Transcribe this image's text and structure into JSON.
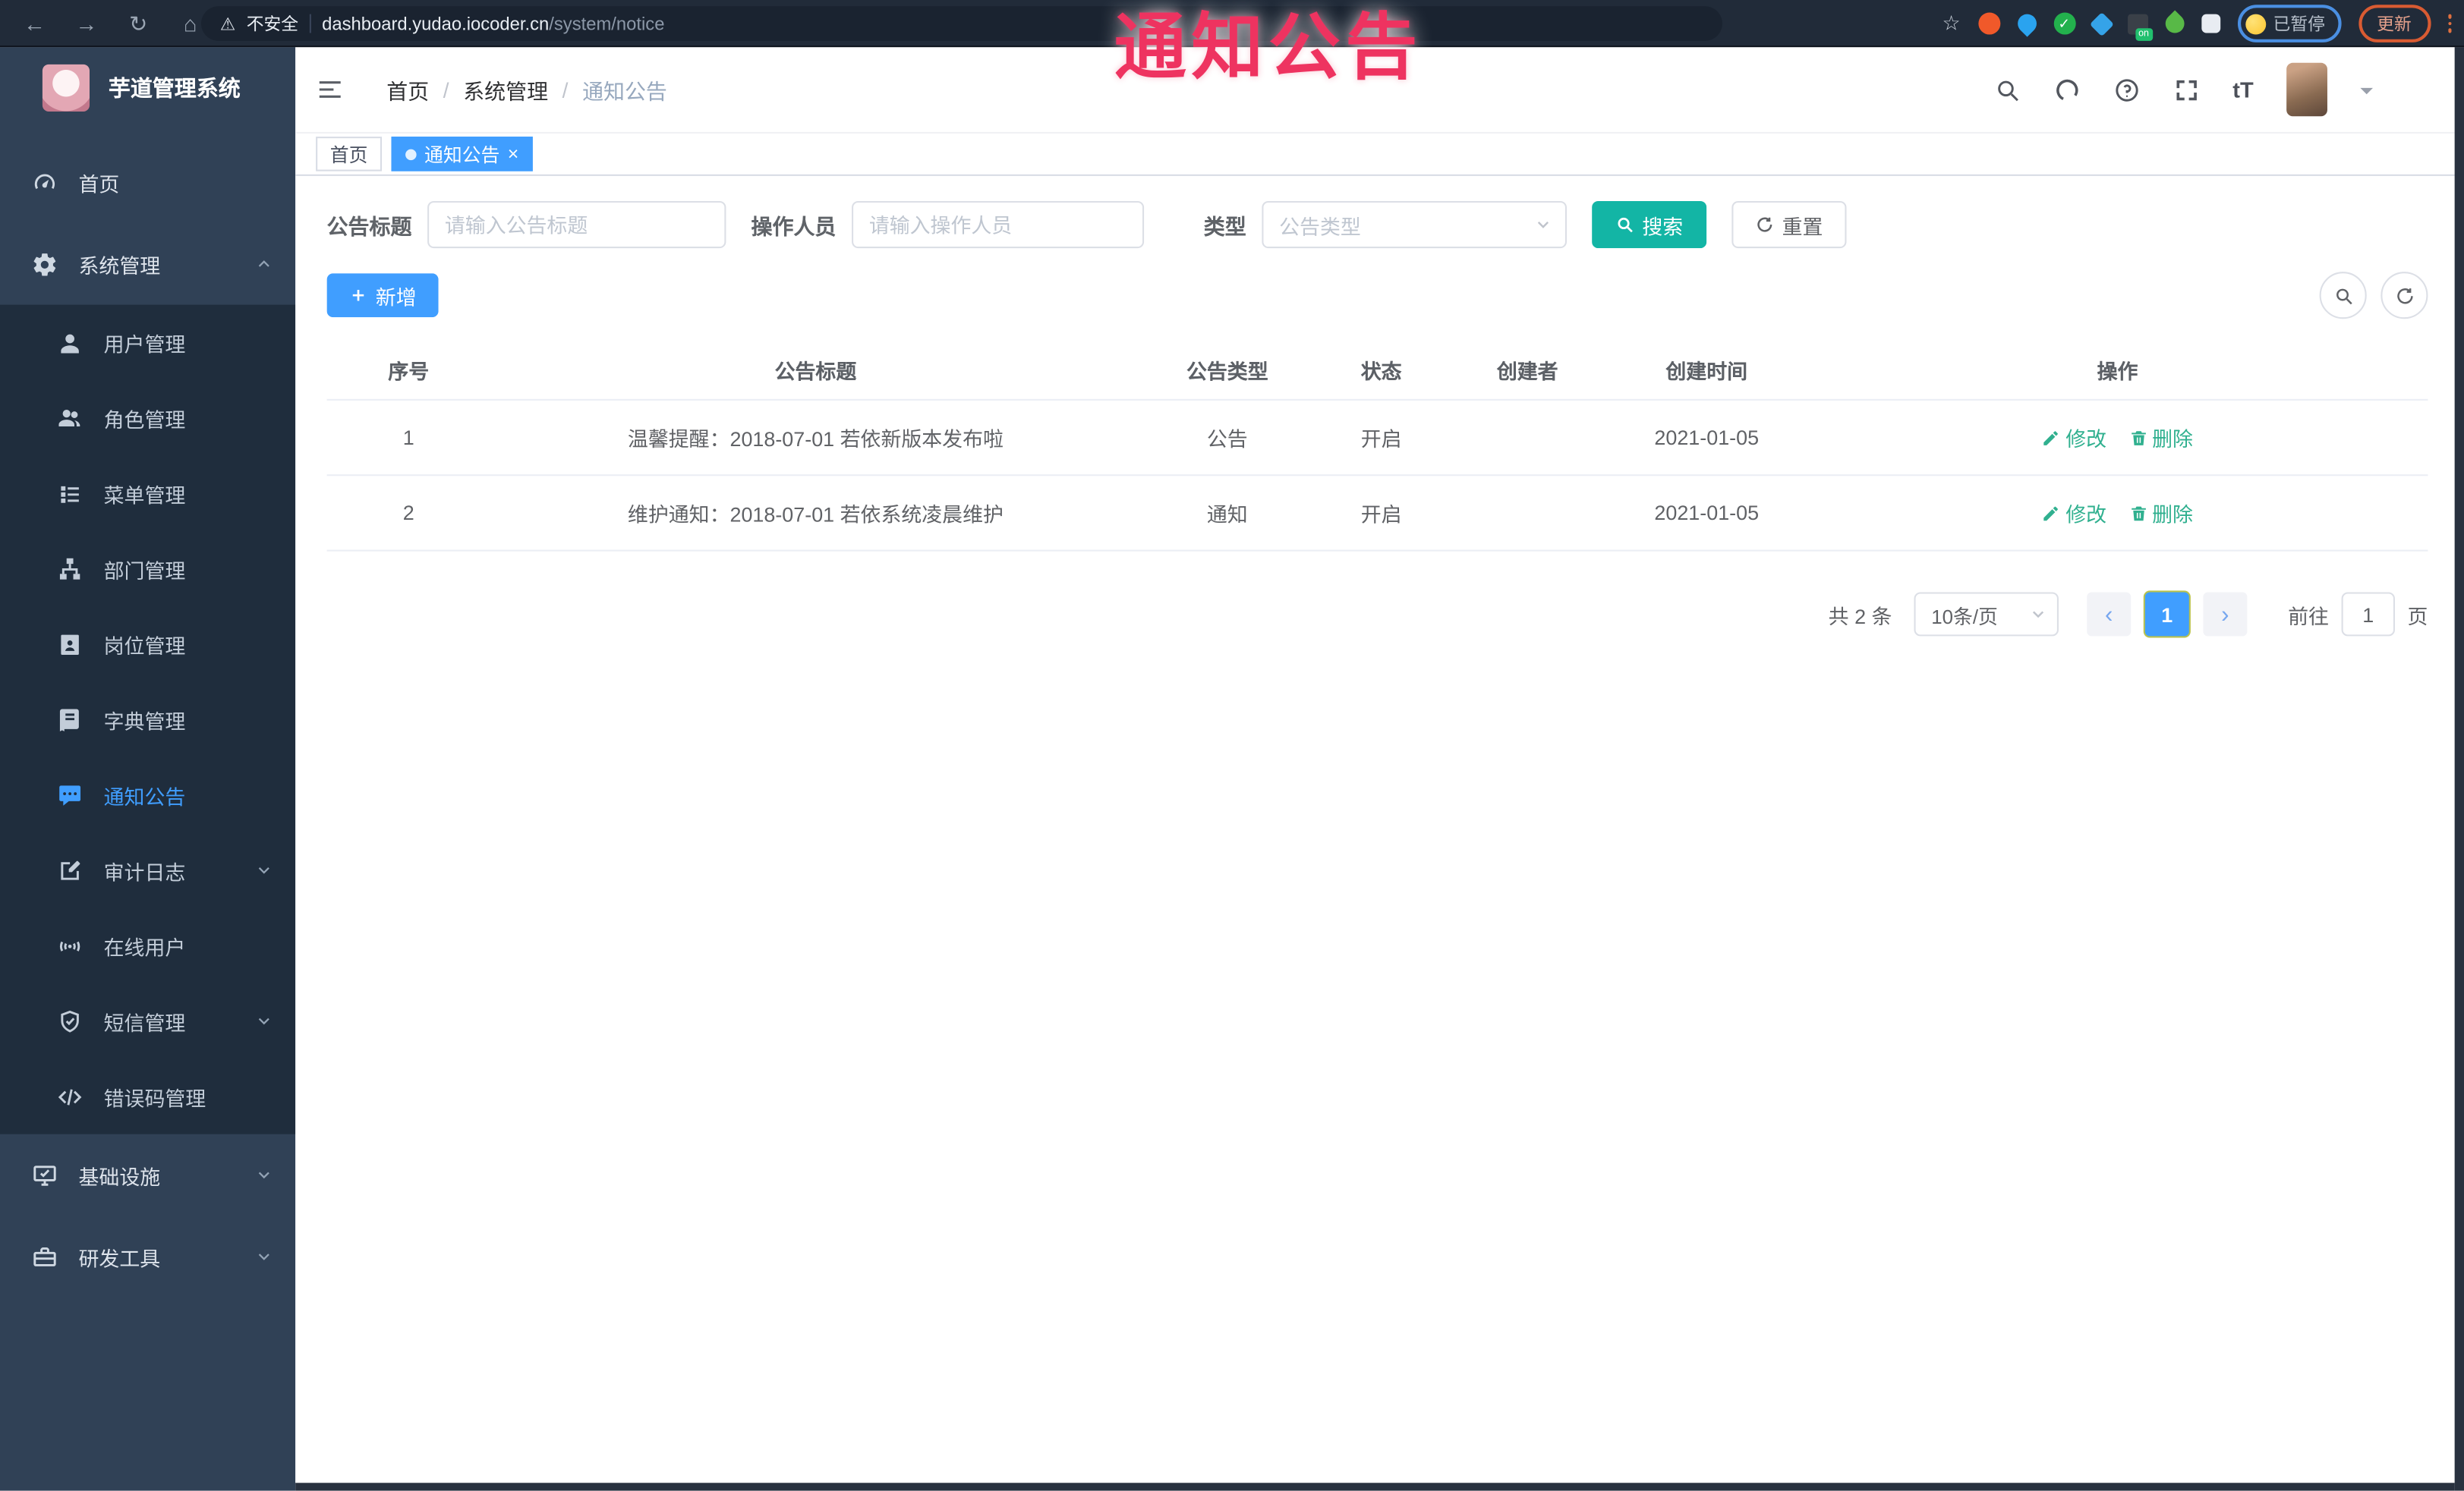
{
  "overlay": {
    "label": "通知公告"
  },
  "browser": {
    "insecure_label": "不安全",
    "url_host": "dashboard.yudao.iocoder.cn",
    "url_path": "/system/notice",
    "proxy_badge": "on",
    "paused_label": "已暂停",
    "update_label": "更新"
  },
  "sidebar": {
    "app_title": "芋道管理系统",
    "items": [
      {
        "name": "home",
        "label": "首页",
        "icon": "dashboard-icon",
        "level": 1
      },
      {
        "name": "system-management",
        "label": "系统管理",
        "icon": "gear-icon",
        "level": 1,
        "chevron": "up"
      },
      {
        "name": "user-management",
        "label": "用户管理",
        "icon": "user-icon",
        "level": 2
      },
      {
        "name": "role-management",
        "label": "角色管理",
        "icon": "users-icon",
        "level": 2
      },
      {
        "name": "menu-management",
        "label": "菜单管理",
        "icon": "menu-list-icon",
        "level": 2
      },
      {
        "name": "dept-management",
        "label": "部门管理",
        "icon": "org-tree-icon",
        "level": 2
      },
      {
        "name": "post-management",
        "label": "岗位管理",
        "icon": "badge-icon",
        "level": 2
      },
      {
        "name": "dict-management",
        "label": "字典管理",
        "icon": "dictionary-icon",
        "level": 2
      },
      {
        "name": "notice",
        "label": "通知公告",
        "icon": "message-icon",
        "level": 2,
        "active": true
      },
      {
        "name": "audit-log",
        "label": "审计日志",
        "icon": "log-icon",
        "level": 2,
        "chevron": "down"
      },
      {
        "name": "online-users",
        "label": "在线用户",
        "icon": "online-users-icon",
        "level": 2
      },
      {
        "name": "sms-management",
        "label": "短信管理",
        "icon": "shield-icon",
        "level": 2,
        "chevron": "down"
      },
      {
        "name": "error-code-management",
        "label": "错误码管理",
        "icon": "code-icon",
        "level": 2
      },
      {
        "name": "infrastructure",
        "label": "基础设施",
        "icon": "infrastructure-icon",
        "level": 1,
        "chevron": "down"
      },
      {
        "name": "dev-tools",
        "label": "研发工具",
        "icon": "devtools-icon",
        "level": 1,
        "chevron": "down"
      }
    ]
  },
  "navbar": {
    "breadcrumb": [
      "首页",
      "系统管理",
      "通知公告"
    ],
    "font_size_icon_text": "tT"
  },
  "tabs": [
    {
      "name": "home",
      "label": "首页",
      "active": false,
      "closable": false
    },
    {
      "name": "notice",
      "label": "通知公告",
      "active": true,
      "closable": true
    }
  ],
  "filters": {
    "title_label": "公告标题",
    "title_placeholder": "请输入公告标题",
    "operator_label": "操作人员",
    "operator_placeholder": "请输入操作人员",
    "type_label": "类型",
    "type_placeholder": "公告类型",
    "search_label": "搜索",
    "reset_label": "重置"
  },
  "toolbar": {
    "add_label": "新增"
  },
  "table": {
    "headers": [
      "序号",
      "公告标题",
      "公告类型",
      "状态",
      "创建者",
      "创建时间",
      "操作"
    ],
    "rows": [
      {
        "no": "1",
        "title": "温馨提醒：2018-07-01 若依新版本发布啦",
        "type": "公告",
        "status": "开启",
        "creator": "",
        "created": "2021-01-05"
      },
      {
        "no": "2",
        "title": "维护通知：2018-07-01 若依系统凌晨维护",
        "type": "通知",
        "status": "开启",
        "creator": "",
        "created": "2021-01-05"
      }
    ],
    "edit_label": "修改",
    "delete_label": "删除"
  },
  "pagination": {
    "total_label": "共 2 条",
    "page_size": "10条/页",
    "prev_symbol": "‹",
    "next_symbol": "›",
    "current_page": "1",
    "goto_label": "前往",
    "goto_value": "1",
    "page_unit": "页"
  },
  "colors": {
    "accent_blue": "#409eff",
    "search_teal": "#13b5a5",
    "action_green": "#30b08f",
    "sidebar_bg": "#304156",
    "submenu_bg": "#1f2d3d",
    "overlay_pink": "#ee3360",
    "chrome_dark": "#212b39"
  }
}
